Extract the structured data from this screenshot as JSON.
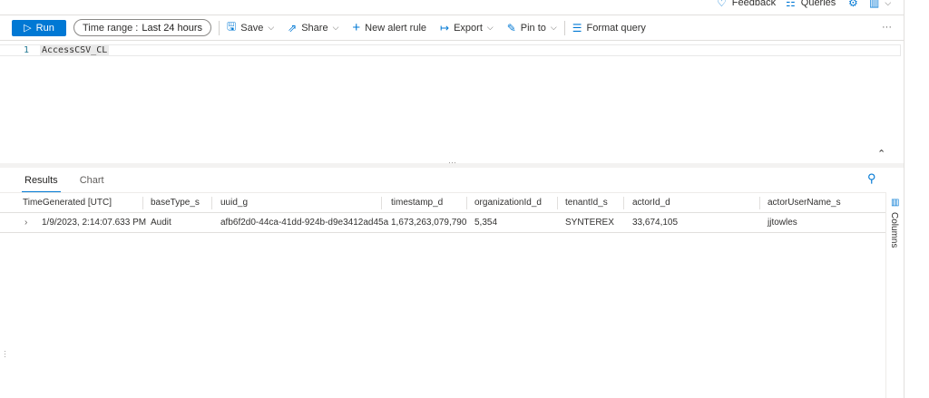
{
  "header": {
    "feedback": "Feedback",
    "queries": "Queries"
  },
  "toolbar": {
    "run": "Run",
    "time_label": "Time range :",
    "time_value": "Last 24 hours",
    "save": "Save",
    "share": "Share",
    "new_alert": "New alert rule",
    "export": "Export",
    "pin": "Pin to",
    "format": "Format query",
    "more": "···"
  },
  "editor": {
    "line_number": "1",
    "query": "AccessCSV_CL"
  },
  "results": {
    "tabs": [
      "Results",
      "Chart"
    ],
    "columns_label": "Columns",
    "headers": [
      "TimeGenerated [UTC]",
      "baseType_s",
      "uuid_g",
      "timestamp_d",
      "organizationId_d",
      "tenantId_s",
      "actorId_d",
      "actorUserName_s"
    ],
    "rows": [
      [
        "1/9/2023, 2:14:07.633 PM",
        "Audit",
        "afb6f2d0-44ca-41dd-924b-d9e3412ad45a",
        "1,673,263,079,790",
        "5,354",
        "SYNTEREX",
        "33,674,105",
        "jjtowles"
      ]
    ]
  },
  "accent": "#0078d4"
}
